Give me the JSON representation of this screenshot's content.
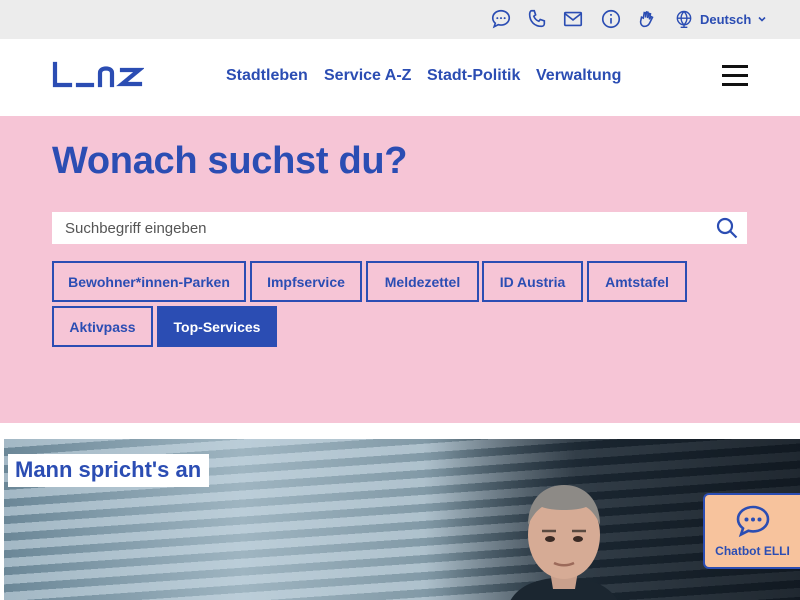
{
  "topbar": {
    "icons": [
      "chat-icon",
      "phone-icon",
      "mail-icon",
      "info-icon",
      "sign-language-icon",
      "globe-icon"
    ],
    "language": "Deutsch"
  },
  "header": {
    "logo": "L_nz",
    "nav": [
      "Stadtleben",
      "Service A-Z",
      "Stadt-Politik",
      "Verwaltung"
    ]
  },
  "search": {
    "headline": "Wonach suchst du?",
    "placeholder": "Suchbegriff eingeben",
    "chips": [
      "Bewohner*innen-Parken",
      "Impfservice",
      "Meldezettel",
      "ID Austria",
      "Amtstafel",
      "Aktivpass",
      "Top-Services"
    ],
    "active_chip": "Top-Services"
  },
  "hero": {
    "title": "Mann spricht's an"
  },
  "chatbot": {
    "label": "Chatbot ELLI"
  },
  "colors": {
    "brand_blue": "#2b4db3",
    "search_bg": "#f6c5d6",
    "topbar_bg": "#ececec",
    "chatbot_bg": "#f7c39d"
  }
}
